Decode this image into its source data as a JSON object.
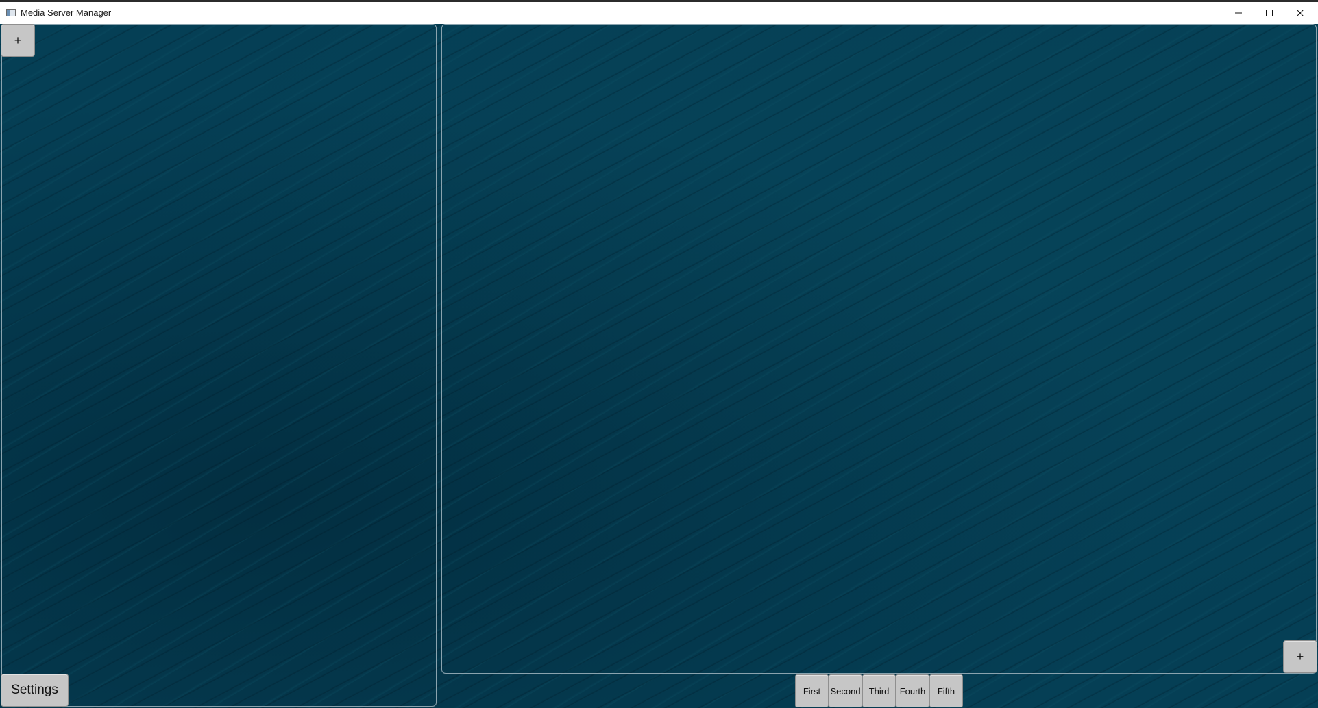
{
  "window": {
    "title": "Media Server Manager",
    "controls": {
      "minimize_icon": "minimize-icon",
      "maximize_icon": "maximize-icon",
      "close_icon": "close-icon"
    }
  },
  "left_panel": {
    "add_label": "+",
    "settings_label": "Settings"
  },
  "right_panel": {
    "add_label": "+"
  },
  "tabs": [
    {
      "label": "First"
    },
    {
      "label": "Second"
    },
    {
      "label": "Third"
    },
    {
      "label": "Fourth"
    },
    {
      "label": "Fifth"
    }
  ],
  "colors": {
    "background": "#053f55",
    "button": "#c6c6c6",
    "panel_border": "#8aa3ae"
  }
}
